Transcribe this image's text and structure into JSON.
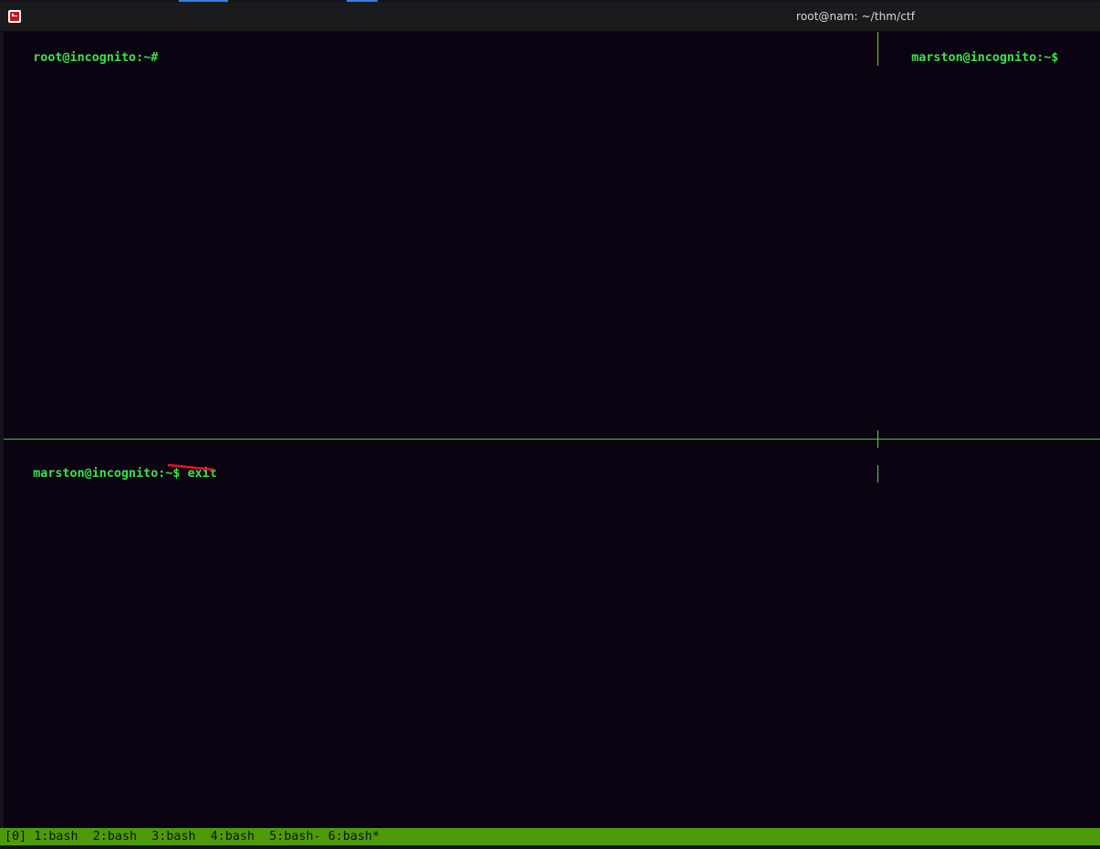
{
  "window": {
    "title": "root@nam: ~/thm/ctf"
  },
  "panes": {
    "top_left": {
      "prompt": "root@incognito:~#"
    },
    "top_right": {
      "prompt": "marston@incognito:~$"
    },
    "bottom": {
      "prompt": "marston@incognito:~$",
      "command": "exit"
    }
  },
  "status_bar": {
    "session": "[0]",
    "windows": [
      "1:bash",
      "2:bash",
      "3:bash",
      "4:bash",
      "5:bash-",
      "6:bash*"
    ]
  },
  "colors": {
    "prompt_green": "#3ae34a",
    "status_bar_green": "#4e9a06",
    "background": "#0b0312",
    "annotation_red": "#e8141c"
  },
  "icons": {
    "app_icon": "terminal-emulator-icon"
  }
}
